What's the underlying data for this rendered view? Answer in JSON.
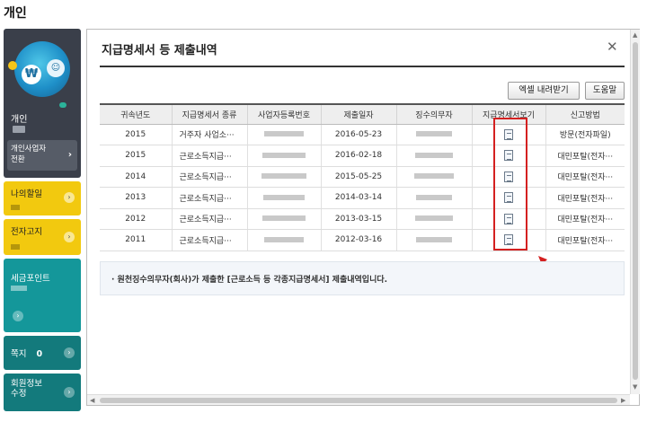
{
  "page_title": "개인",
  "sidebar": {
    "profile_label": "개인",
    "coin_symbol": "₩",
    "switch_button": "개인사업자\n전환",
    "tiles": [
      {
        "label": "나의할일",
        "theme": "yellow"
      },
      {
        "label": "전자고지",
        "theme": "yellow"
      },
      {
        "label": "세금포인트",
        "theme": "teal"
      },
      {
        "label": "쪽지",
        "count": "0",
        "theme": "dark-teal"
      },
      {
        "label": "회원정보\n수정",
        "theme": "dark-teal"
      }
    ]
  },
  "modal": {
    "title": "지급명세서 등 제출내역",
    "excel_button": "엑셀 내려받기",
    "help_button": "도움말",
    "columns": [
      "귀속년도",
      "지급명세서 종류",
      "사업자등록번호",
      "제출일자",
      "징수의무자",
      "지급명세서보기",
      "신고방법"
    ],
    "rows": [
      {
        "year": "2015",
        "type": "거주자 사업소···",
        "date": "2016-05-23",
        "method": "방문(전자파일)"
      },
      {
        "year": "2015",
        "type": "근로소득지급···",
        "date": "2016-02-18",
        "method": "대민포탈(전자···"
      },
      {
        "year": "2014",
        "type": "근로소득지급···",
        "date": "2015-05-25",
        "method": "대민포탈(전자···"
      },
      {
        "year": "2013",
        "type": "근로소득지급···",
        "date": "2014-03-14",
        "method": "대민포탈(전자···"
      },
      {
        "year": "2012",
        "type": "근로소득지급···",
        "date": "2013-03-15",
        "method": "대민포탈(전자···"
      },
      {
        "year": "2011",
        "type": "근로소득지급···",
        "date": "2012-03-16",
        "method": "대민포탈(전자···"
      }
    ],
    "notice": "· 원천징수의무자(회사)가 제출한 [근로소득 등 각종지급명세서] 제출내역입니다.",
    "highlight_color": "#d42020"
  }
}
